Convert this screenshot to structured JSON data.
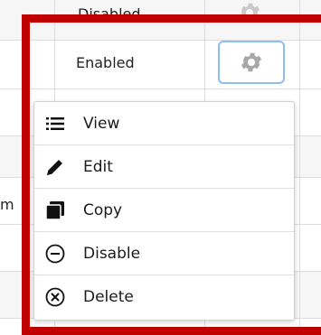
{
  "table": {
    "row_above_status": "Disabled",
    "row_status": "Enabled",
    "partial_cell_text": "m"
  },
  "action_menu": {
    "items": [
      {
        "label": "View",
        "icon": "list-icon"
      },
      {
        "label": "Edit",
        "icon": "pencil-icon"
      },
      {
        "label": "Copy",
        "icon": "copy-icon"
      },
      {
        "label": "Disable",
        "icon": "minus-circle-icon"
      },
      {
        "label": "Delete",
        "icon": "x-circle-icon"
      }
    ]
  },
  "colors": {
    "highlight_frame": "#c00000",
    "gear_focus_border": "#8dbef0",
    "gear_icon": "#a8a8a8"
  }
}
